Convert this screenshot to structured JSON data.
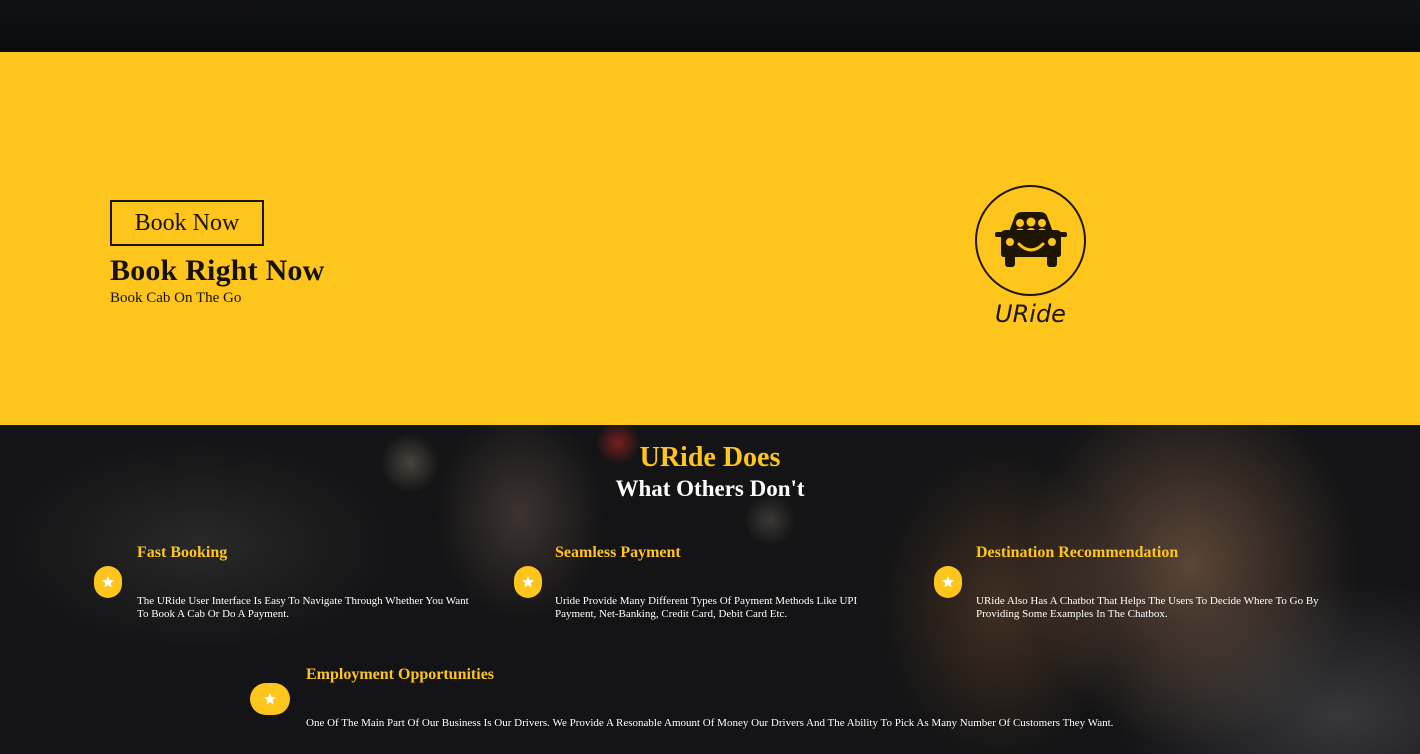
{
  "hero": {
    "cta_label": "Book Now",
    "title": "Book Right Now",
    "subtitle": "Book Cab On The Go",
    "logo_text": "URide"
  },
  "features_section": {
    "title": "URide Does",
    "subtitle": "What Others Don't",
    "items": [
      {
        "title": "Fast Booking",
        "description": "The URide User Interface Is Easy To Navigate Through Whether You Want To Book A Cab Or Do A Payment.",
        "icon": "star-icon"
      },
      {
        "title": "Seamless Payment",
        "description": "Uride Provide Many Different Types Of Payment Methods Like UPI Payment, Net-Banking, Credit Card, Debit Card Etc.",
        "icon": "star-icon"
      },
      {
        "title": "Destination Recommendation",
        "description": "URide Also Has A Chatbot That Helps The Users To Decide Where To Go By Providing Some Examples In The Chatbox.",
        "icon": "star-icon"
      },
      {
        "title": "Employment Opportunities",
        "description": "One Of The Main Part Of Our Business Is Our Drivers. We Provide A Resonable Amount Of Money Our Drivers And The Ability To Pick As Many Number Of Customers They Want.",
        "icon": "star-icon"
      }
    ]
  },
  "colors": {
    "accent": "#fec51c",
    "dark": "#16110a",
    "background_dark": "#141416"
  }
}
